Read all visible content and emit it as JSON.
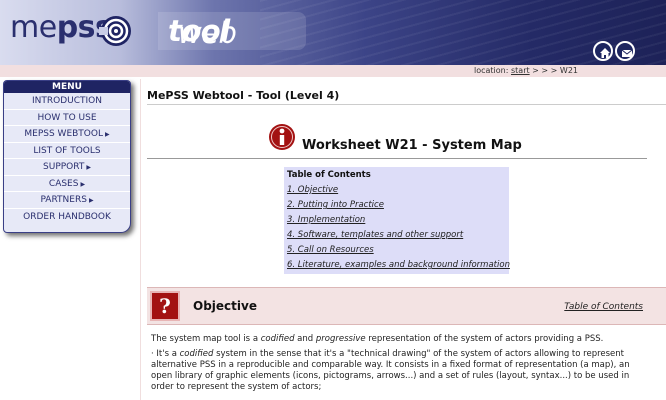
{
  "header": {
    "logo_light": "me",
    "logo_bold": "pss",
    "webtool_light": "web",
    "webtool_bold": "tool",
    "home_icon": "home-icon",
    "mail_icon": "mail-icon",
    "colors": {
      "dark": "#1f2463",
      "accent": "#a31212"
    }
  },
  "location": {
    "prefix": "location:",
    "start_link": "start",
    "trail": "> > > W21"
  },
  "menu": {
    "title": "MENU",
    "items": [
      {
        "label": "INTRODUCTION",
        "has_arrow": false
      },
      {
        "label": "HOW TO USE",
        "has_arrow": false
      },
      {
        "label": "MEPSS WEBTOOL",
        "has_arrow": true
      },
      {
        "label": "LIST OF TOOLS",
        "has_arrow": false
      },
      {
        "label": "SUPPORT",
        "has_arrow": true
      },
      {
        "label": "CASES",
        "has_arrow": true
      },
      {
        "label": "PARTNERS",
        "has_arrow": true
      },
      {
        "label": "ORDER HANDBOOK",
        "has_arrow": false
      }
    ]
  },
  "page": {
    "title": "MePSS Webtool - Tool (Level 4)",
    "worksheet_title": "Worksheet W21 - System Map",
    "info_icon": "info-icon"
  },
  "toc": {
    "title": "Table of Contents",
    "links": [
      "1. Objective",
      "2. Putting into Practice",
      "3. Implementation",
      "4. Software, templates and other support",
      "5. Call on Resources",
      "6. Literature, examples and background information"
    ]
  },
  "objective": {
    "icon": "question-icon",
    "heading": "Objective",
    "toc_link": "Table of Contents",
    "p1_a": "The system map tool is a ",
    "p1_b": "codified",
    "p1_c": " and ",
    "p1_d": "progressive",
    "p1_e": " representation of the system of actors providing a PSS.",
    "p2_a": "· It's a ",
    "p2_b": "codified",
    "p2_c": " system in the sense that it's a \"technical drawing\" of the system of actors allowing to represent alternative PSS in a reproducible and comparable way. It consists in a fixed format of representation (a map), an open library of graphic elements (icons, pictograms, arrows...) and a set of rules (layout, syntax...) to be used in order to represent the system of actors;"
  }
}
